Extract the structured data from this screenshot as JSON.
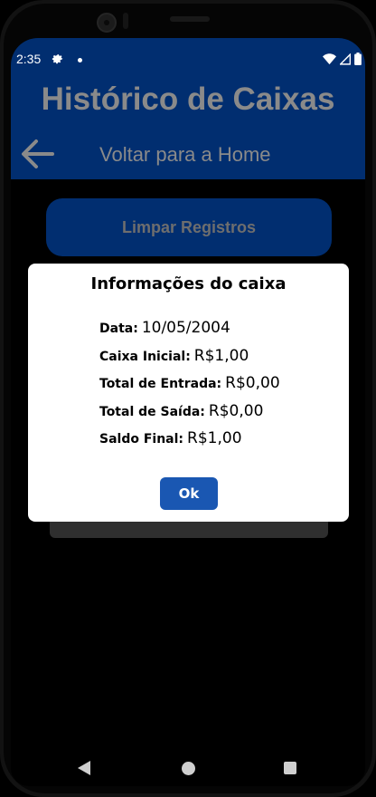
{
  "status_bar": {
    "time": "2:35",
    "icons": [
      "gear-icon",
      "notification-dot-icon",
      "wifi-icon",
      "signal-icon",
      "battery-icon"
    ]
  },
  "header": {
    "title": "Histórico de Caixas",
    "back_label": "Voltar para a Home"
  },
  "actions": {
    "clear_label": "Limpar Registros"
  },
  "dialog": {
    "title": "Informações do caixa",
    "fields": [
      {
        "label": "Data:",
        "value": "10/05/2004"
      },
      {
        "label": "Caixa Inicial:",
        "value": "R$1,00"
      },
      {
        "label": "Total de Entrada:",
        "value": "R$0,00"
      },
      {
        "label": "Total de Saída:",
        "value": "R$0,00"
      },
      {
        "label": "Saldo Final:",
        "value": "R$1,00"
      }
    ],
    "ok_label": "Ok"
  },
  "colors": {
    "header_bg": "#012e70",
    "ok_button": "#1a57b2",
    "header_text": "#8a8a8a"
  }
}
